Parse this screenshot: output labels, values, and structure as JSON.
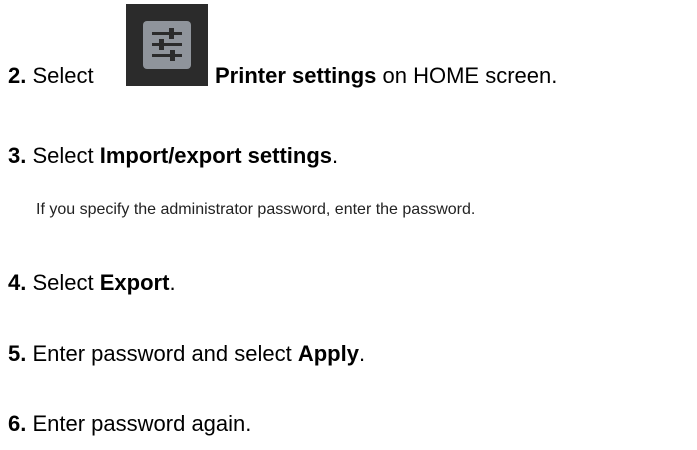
{
  "steps": [
    {
      "number": "2.",
      "before": "Select",
      "bold": "Printer settings",
      "after": "on HOME screen.",
      "icon": "printer-settings-sliders-icon"
    },
    {
      "number": "3.",
      "before": "Select ",
      "bold": "Import/export settings",
      "after": "."
    },
    {
      "number": "4.",
      "before": "Select ",
      "bold": "Export",
      "after": "."
    },
    {
      "number": "5.",
      "before": "Enter password and select ",
      "bold": "Apply",
      "after": "."
    },
    {
      "number": "6.",
      "before": "Enter password again.",
      "bold": "",
      "after": ""
    }
  ],
  "note": "If you specify the administrator password, enter the password.",
  "colors": {
    "icon_bg": "#2b2b2b",
    "icon_tile": "#8f949b",
    "text": "#000000"
  }
}
